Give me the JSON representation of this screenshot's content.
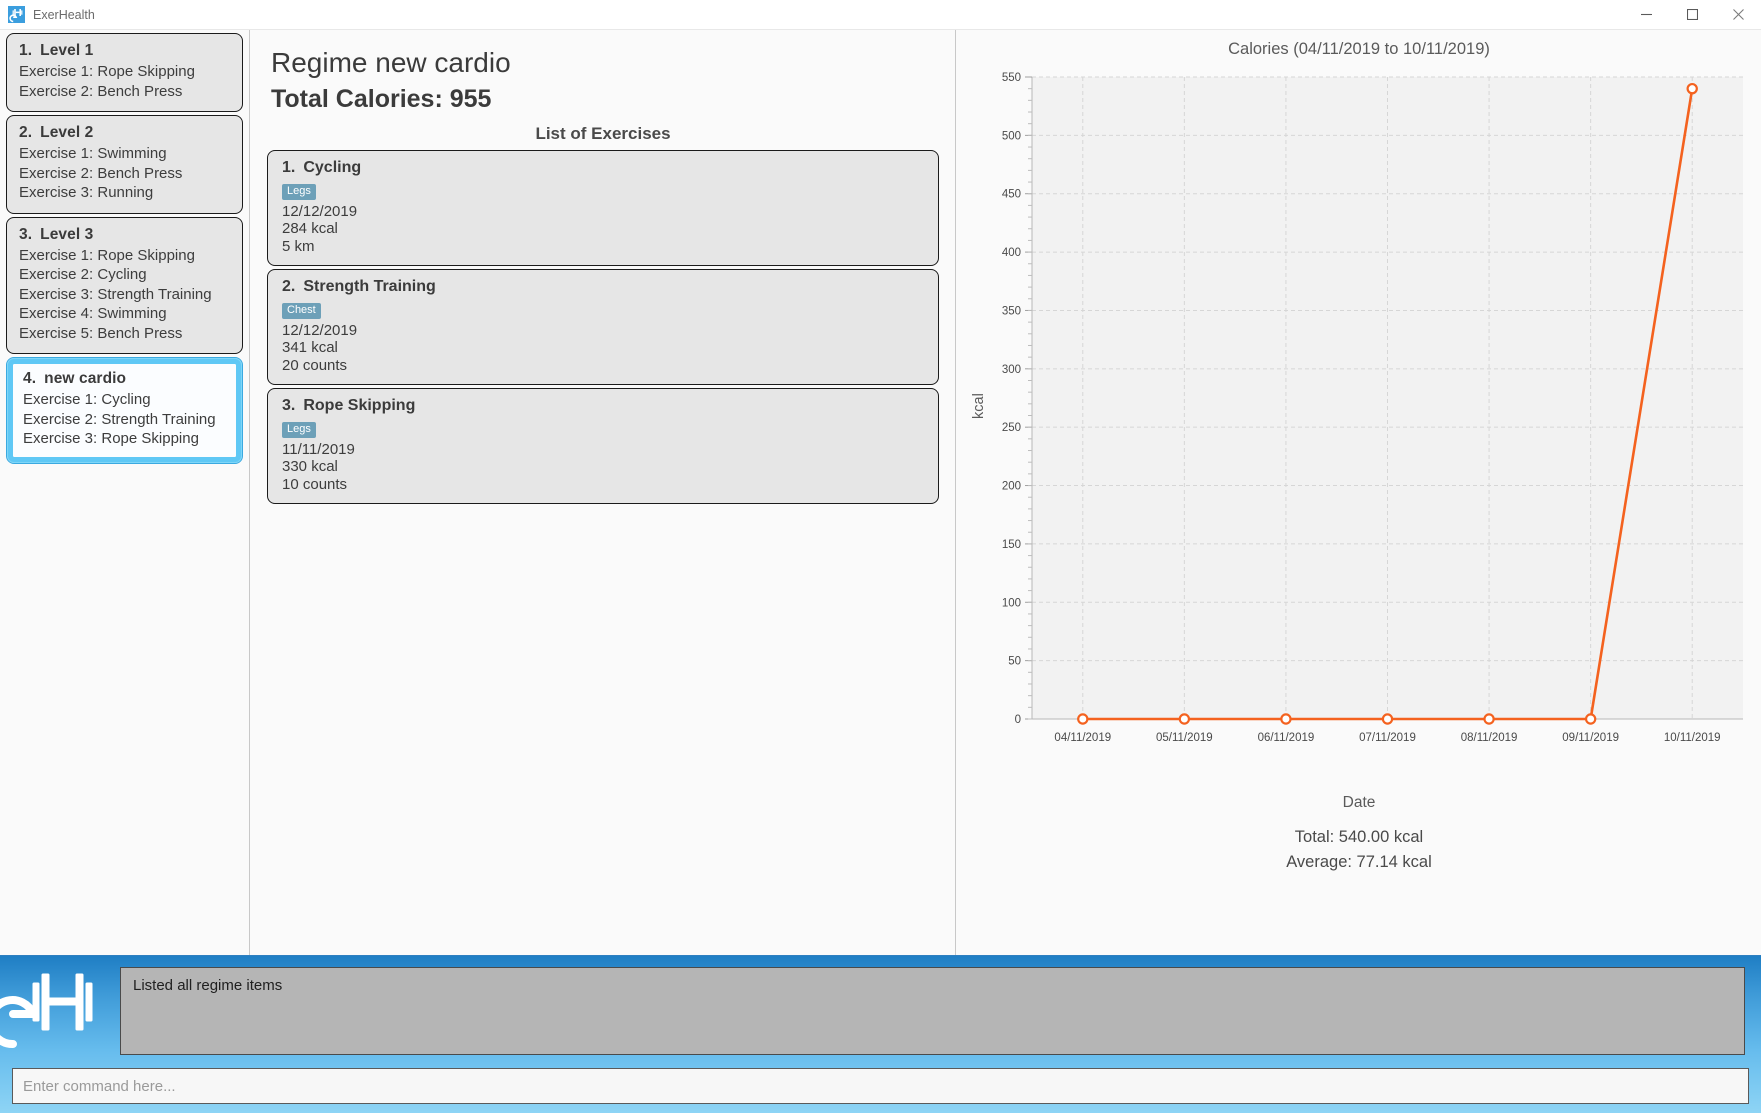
{
  "window": {
    "title": "ExerHealth",
    "app_icon": "exerhealth-logo-icon",
    "minimize_label": "Minimize",
    "maximize_label": "Maximize",
    "close_label": "Close"
  },
  "sidebar": {
    "regimes": [
      {
        "num": "1.",
        "name": "Level 1",
        "exercises": [
          "Exercise 1: Rope Skipping",
          "Exercise 2: Bench Press"
        ],
        "selected": false
      },
      {
        "num": "2.",
        "name": "Level 2",
        "exercises": [
          "Exercise 1: Swimming",
          "Exercise 2: Bench Press",
          "Exercise 3: Running"
        ],
        "selected": false
      },
      {
        "num": "3.",
        "name": "Level 3",
        "exercises": [
          "Exercise 1: Rope Skipping",
          "Exercise 2: Cycling",
          "Exercise 3: Strength Training",
          "Exercise 4: Swimming",
          "Exercise 5: Bench Press"
        ],
        "selected": false
      },
      {
        "num": "4.",
        "name": "new cardio",
        "exercises": [
          "Exercise 1: Cycling",
          "Exercise 2: Strength Training",
          "Exercise 3: Rope Skipping"
        ],
        "selected": true
      }
    ]
  },
  "main": {
    "regime_heading": "Regime new cardio",
    "total_calories": "Total Calories: 955",
    "list_label": "List of Exercises",
    "exercises": [
      {
        "num": "1.",
        "name": "Cycling",
        "badge": "Legs",
        "date": "12/12/2019",
        "calories": "284 kcal",
        "metric": "5 km"
      },
      {
        "num": "2.",
        "name": "Strength Training",
        "badge": "Chest",
        "date": "12/12/2019",
        "calories": "341 kcal",
        "metric": "20 counts"
      },
      {
        "num": "3.",
        "name": "Rope Skipping",
        "badge": "Legs",
        "date": "11/11/2019",
        "calories": "330 kcal",
        "metric": "10 counts"
      }
    ]
  },
  "chart_panel": {
    "total": "Total: 540.00 kcal",
    "average": "Average: 77.14 kcal"
  },
  "chart_data": {
    "type": "line",
    "title": "Calories (04/11/2019 to 10/11/2019)",
    "xlabel": "Date",
    "ylabel": "kcal",
    "categories": [
      "04/11/2019",
      "05/11/2019",
      "06/11/2019",
      "07/11/2019",
      "08/11/2019",
      "09/11/2019",
      "10/11/2019"
    ],
    "values": [
      0,
      0,
      0,
      0,
      0,
      0,
      540
    ],
    "ylim": [
      0,
      550
    ],
    "yticks": [
      0,
      50,
      100,
      150,
      200,
      250,
      300,
      350,
      400,
      450,
      500,
      550
    ],
    "minor_ticks_per_interval": 5,
    "grid": true,
    "legend": "none",
    "line_color": "#f4621f",
    "marker": "open-circle",
    "marker_face": "#ffffff"
  },
  "console": {
    "logo_icon": "exerhealth-logo-icon",
    "output_message": "Listed all regime items",
    "command_placeholder": "Enter command here..."
  }
}
